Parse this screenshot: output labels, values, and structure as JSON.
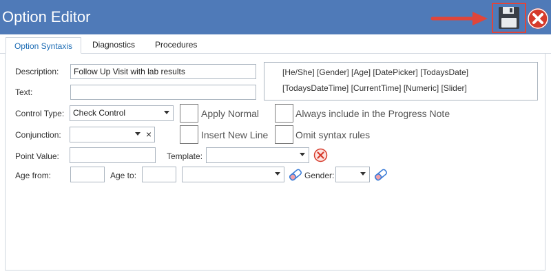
{
  "window": {
    "title": "Option Editor"
  },
  "toolbar": {
    "save_icon": "floppy-disk-icon",
    "close_icon": "close-icon",
    "arrow_icon": "red-arrow-icon",
    "accent": "#e0453a"
  },
  "tabs": [
    {
      "label": "Option Syntaxis",
      "active": true
    },
    {
      "label": "Diagnostics",
      "active": false
    },
    {
      "label": "Procedures",
      "active": false
    }
  ],
  "form": {
    "description_label": "Description:",
    "description_value": "Follow Up Visit with lab results",
    "text_label": "Text:",
    "text_value": "",
    "control_type_label": "Control Type:",
    "control_type_value": "Check Control",
    "conjunction_label": "Conjunction:",
    "conjunction_value": "",
    "conjunction_clear": "×",
    "point_value_label": "Point Value:",
    "point_value": "",
    "template_label": "Template:",
    "template_value": "",
    "age_from_label": "Age from:",
    "age_from_value": "",
    "age_to_label": "Age to:",
    "age_to_value": "",
    "age_unit_value": "",
    "gender_label": "Gender:",
    "gender_value": ""
  },
  "checkboxes": {
    "apply_normal": "Apply Normal",
    "always_include": "Always include in the Progress Note",
    "insert_new_line": "Insert New Line",
    "omit_syntax": "Omit syntax rules"
  },
  "macros": {
    "row1": "[He/She]  [Gender]  [Age]  [DatePicker]  [TodaysDate]",
    "row2": "[TodaysDateTime]  [CurrentTime]  [Numeric]  [Slider]"
  }
}
